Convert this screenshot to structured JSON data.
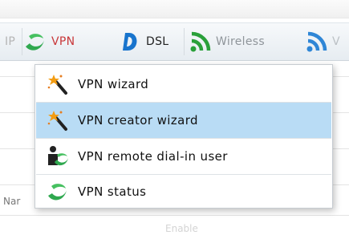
{
  "nav": {
    "tabs": [
      {
        "label": "IP",
        "state": "inactive"
      },
      {
        "label": "VPN",
        "state": "active"
      },
      {
        "label": "DSL",
        "state": "inactive"
      },
      {
        "label": "Wireless",
        "state": "inactive"
      },
      {
        "label": "V",
        "state": "inactive"
      }
    ]
  },
  "vpn_menu": {
    "items": [
      {
        "label": "VPN wizard",
        "icon": "magic-wand-icon"
      },
      {
        "label": "VPN creator wizard",
        "icon": "magic-wand-icon",
        "selected": true
      },
      {
        "label": "VPN remote dial-in user",
        "icon": "user-vpn-icon"
      },
      {
        "label": "VPN status",
        "icon": "vpn-icon"
      }
    ]
  },
  "background": {
    "column_fragment": "Nar",
    "faded_text": "Enable"
  },
  "colors": {
    "vpn_green": "#2fa84f",
    "dsl_blue": "#1874cd",
    "wireless_green": "#2aa03a",
    "selected_row": "#b9dcf5",
    "active_tab_text": "#c9383a"
  }
}
